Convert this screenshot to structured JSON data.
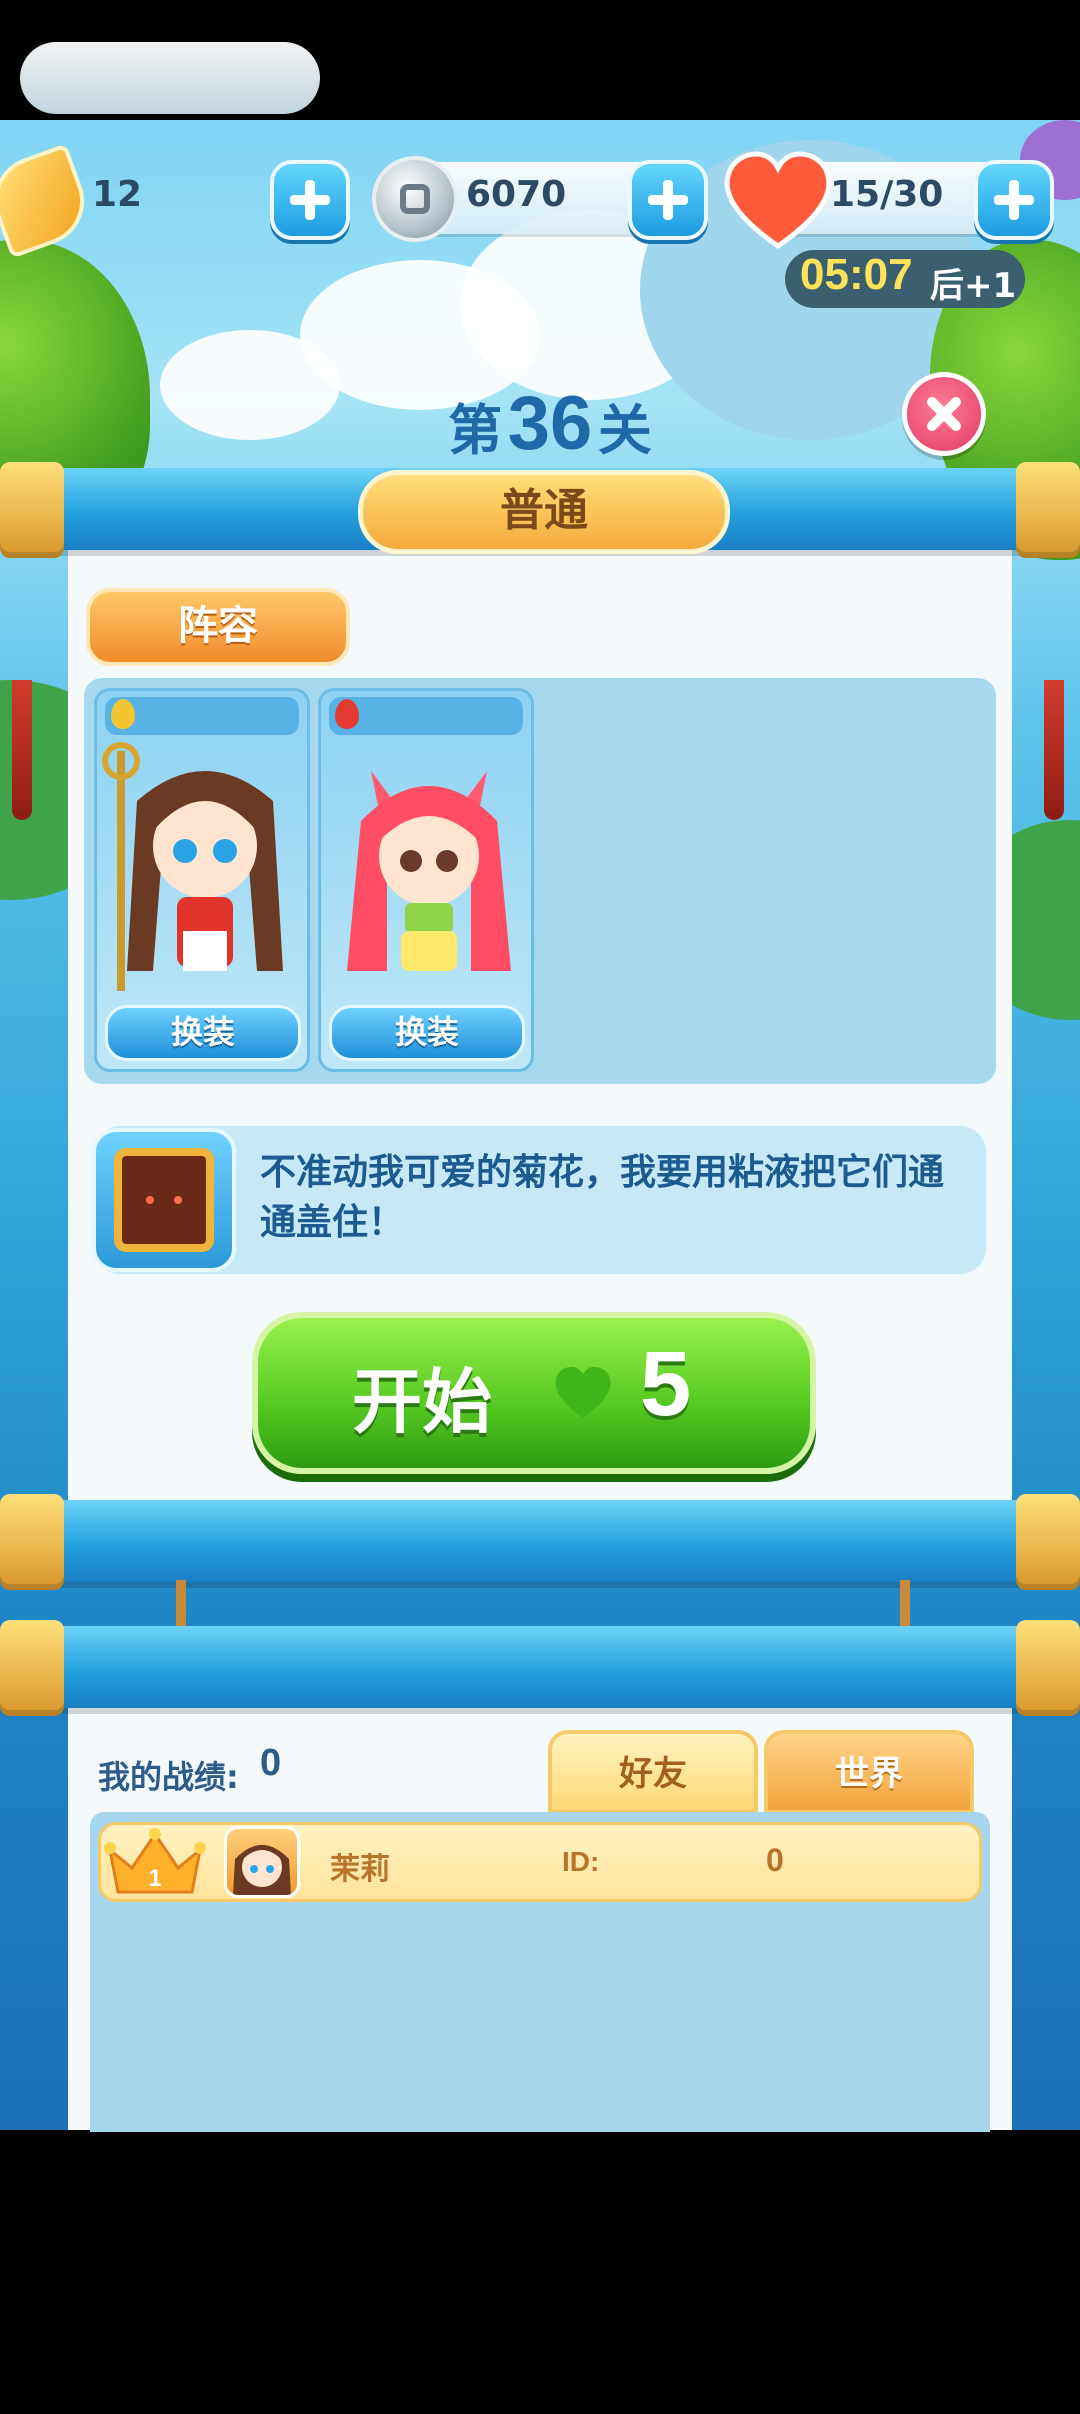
{
  "resources": {
    "feathers": "12",
    "coins": "6070",
    "lives": "15/30"
  },
  "timer": {
    "countdown": "05:07",
    "suffix": "后+1"
  },
  "level": {
    "prefix": "第",
    "number": "36",
    "suffix": "关",
    "difficulty": "普通"
  },
  "lineup": {
    "tab_label": "阵容",
    "heroes": [
      {
        "element": "gold",
        "swap_label": "换装"
      },
      {
        "element": "red",
        "swap_label": "换装"
      }
    ]
  },
  "dialogue": {
    "text": "不准动我可爱的菊花，我要用粘液把它们通通盖住！"
  },
  "start_button": {
    "label": "开始",
    "cost": "5"
  },
  "leaderboard": {
    "my_record_label": "我的战绩:",
    "my_record_value": "0",
    "tabs": [
      "好友",
      "世界"
    ],
    "rows": [
      {
        "rank": "1",
        "name": "茉莉",
        "id_label": "ID:",
        "score": "0"
      }
    ]
  },
  "colors": {
    "accent_blue": "#1e6aa8",
    "start_green": "#58cc23",
    "difficulty_gold": "#f5a93a"
  }
}
